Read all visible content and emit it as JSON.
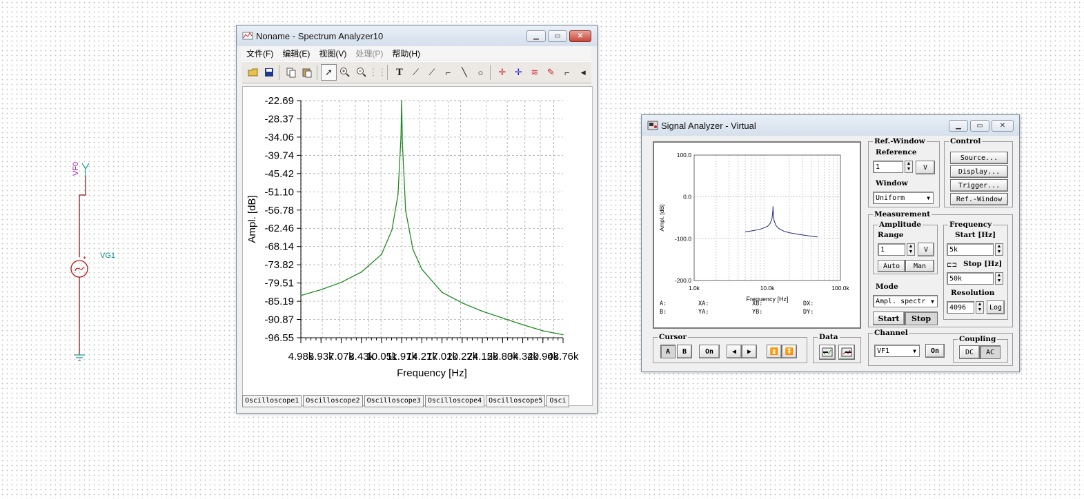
{
  "schematic": {
    "probe_label": "VF0",
    "source_label": "VG1"
  },
  "spectrum_window": {
    "title": "Noname - Spectrum Analyzer10",
    "menu": [
      {
        "label": "文件(F)",
        "disabled": false
      },
      {
        "label": "编辑(E)",
        "disabled": false
      },
      {
        "label": "视图(V)",
        "disabled": false
      },
      {
        "label": "处理(P)",
        "disabled": true
      },
      {
        "label": "帮助(H)",
        "disabled": false
      }
    ],
    "toolbar_icons": [
      "open-icon",
      "save-icon",
      "copy-icon",
      "paste-icon",
      "pointer-icon",
      "zoom-in-icon",
      "zoom-out-icon",
      "grid-icon",
      "text-icon",
      "label-icon",
      "label-arrow-icon",
      "axis-label-icon",
      "line-icon",
      "circle-icon",
      "cursor-a-icon",
      "cursor-b-icon",
      "curves-icon",
      "marker-icon",
      "polyline-icon",
      "scroll-left-icon"
    ],
    "sheet_tabs": [
      "Oscilloscope1",
      "Oscilloscope2",
      "Oscilloscope3",
      "Oscilloscope4",
      "Oscilloscope5",
      "Osci"
    ]
  },
  "chart_data": {
    "type": "line",
    "title": "",
    "xlabel": "Frequency [Hz]",
    "ylabel": "Ampl. [dB]",
    "ylim": [
      -96.55,
      -22.69
    ],
    "y_ticks": [
      "-22.69",
      "-28.37",
      "-34.06",
      "-39.74",
      "-45.42",
      "-51.10",
      "-56.78",
      "-62.46",
      "-68.14",
      "-73.82",
      "-79.51",
      "-85.19",
      "-90.87",
      "-96.55"
    ],
    "x_ticks": [
      "4.98k",
      "5.93k",
      "7.07k",
      "8.43k",
      "10.05k",
      "11.97k",
      "14.27k",
      "17.01k",
      "20.27k",
      "24.15k",
      "28.80k",
      "34.32k",
      "40.90k",
      "48.76k"
    ],
    "grid": true,
    "series": [
      {
        "color": "#1f8a1f",
        "x": [
          4980,
          5930,
          7070,
          8430,
          10050,
          11000,
          11600,
          11900,
          11970,
          12050,
          12400,
          13200,
          14270,
          17010,
          20270,
          24150,
          28800,
          34320,
          40900,
          48760
        ],
        "y": [
          -83.4,
          -81.6,
          -79.3,
          -76.1,
          -70.6,
          -63.0,
          -52.0,
          -34.0,
          -22.69,
          -36.0,
          -57.0,
          -69.0,
          -75.2,
          -82.4,
          -85.7,
          -88.3,
          -90.4,
          -92.5,
          -94.4,
          -95.6
        ]
      }
    ]
  },
  "signal_window": {
    "title": "Signal Analyzer - Virtual",
    "mini_chart": {
      "y_ticks": [
        "100.0",
        "0.0",
        "-100.0",
        "-200.0"
      ],
      "x_ticks": [
        "1.0k",
        "10.0k",
        "100.0k"
      ],
      "xlabel": "Frequency [Hz]",
      "ylabel": "Ampl. [dB]",
      "readouts": [
        "A:",
        "XA:",
        "XB:",
        "DX:",
        "B:",
        "YA:",
        "YB:",
        "DY:"
      ]
    },
    "ref_window": {
      "title": "Ref.-Window",
      "reference_label": "Reference",
      "reference_value": "1",
      "unit_button": "V",
      "window_label": "Window",
      "window_value": "Uniform"
    },
    "control": {
      "title": "Control",
      "buttons": [
        "Source...",
        "Display...",
        "Trigger...",
        "Ref.-Window"
      ]
    },
    "measurement": {
      "title": "Measurement",
      "amplitude_title": "Amplitude",
      "range_label": "Range",
      "range_value": "1",
      "range_unit": "V",
      "auto_label": "Auto",
      "man_label": "Man",
      "mode_label": "Mode",
      "mode_value": "Ampl. spectr",
      "start_label": "Start",
      "stop_label": "Stop",
      "frequency_title": "Frequency",
      "start_hz_label": "Start [Hz]",
      "start_hz_value": "5k",
      "stop_hz_label": "Stop [Hz]",
      "stop_hz_value": "50k",
      "resolution_label": "Resolution",
      "resolution_value": "4096",
      "log_label": "Log"
    },
    "cursor": {
      "title": "Cursor",
      "a_label": "A",
      "b_label": "B",
      "on_label": "On"
    },
    "data_title": "Data",
    "channel": {
      "title": "Channel",
      "value": "VF1",
      "on_label": "On"
    },
    "coupling": {
      "title": "Coupling",
      "dc_label": "DC",
      "ac_label": "AC"
    }
  }
}
